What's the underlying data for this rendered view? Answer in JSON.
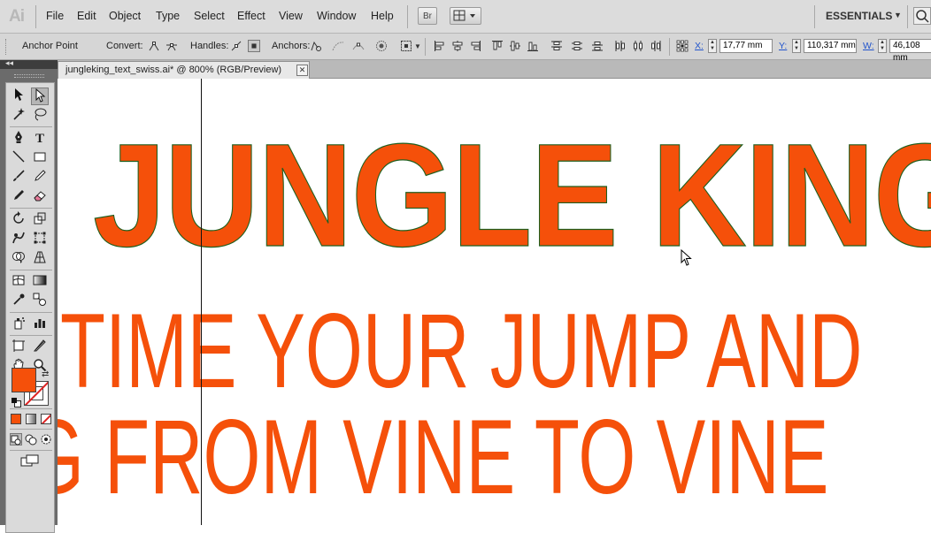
{
  "app": {
    "logo": "Ai"
  },
  "menu": {
    "items": [
      "File",
      "Edit",
      "Object",
      "Type",
      "Select",
      "Effect",
      "View",
      "Window",
      "Help"
    ],
    "bridge_button": "Br"
  },
  "workspace": {
    "label": "ESSENTIALS"
  },
  "control_bar": {
    "selection_label": "Anchor Point",
    "convert_label": "Convert:",
    "handles_label": "Handles:",
    "anchors_label": "Anchors:",
    "x_label": "X:",
    "x_value": "17,77 mm",
    "y_label": "Y:",
    "y_value": "110,317 mm",
    "w_label": "W:",
    "w_value": "46,108 mm"
  },
  "document_tab": {
    "title": "jungleking_text_swiss.ai* @ 800% (RGB/Preview)",
    "close": "✕"
  },
  "canvas": {
    "line1": "JUNGLE KING",
    "line2": "TIME YOUR JUMP AND",
    "line3": "G FROM VINE TO VINE"
  },
  "colors": {
    "fill": "#f5500a",
    "anchor_outline": "#1f5f1f",
    "accent": "#2255cc"
  },
  "tools_panel": {
    "collapse": "◂◂",
    "tools": [
      "selection-tool",
      "direct-selection-tool",
      "magic-wand-tool",
      "lasso-tool",
      "pen-tool",
      "type-tool",
      "line-tool",
      "rectangle-tool",
      "paintbrush-tool",
      "pencil-tool",
      "blob-brush-tool",
      "eraser-tool",
      "rotate-tool",
      "scale-tool",
      "warp-tool",
      "free-transform-tool",
      "shape-builder-tool",
      "perspective-grid-tool",
      "mesh-tool",
      "gradient-tool",
      "eyedropper-tool",
      "blend-tool",
      "symbol-sprayer-tool",
      "column-graph-tool",
      "artboard-tool",
      "slice-tool",
      "hand-tool",
      "zoom-tool"
    ],
    "type_tool_glyph": "T"
  }
}
